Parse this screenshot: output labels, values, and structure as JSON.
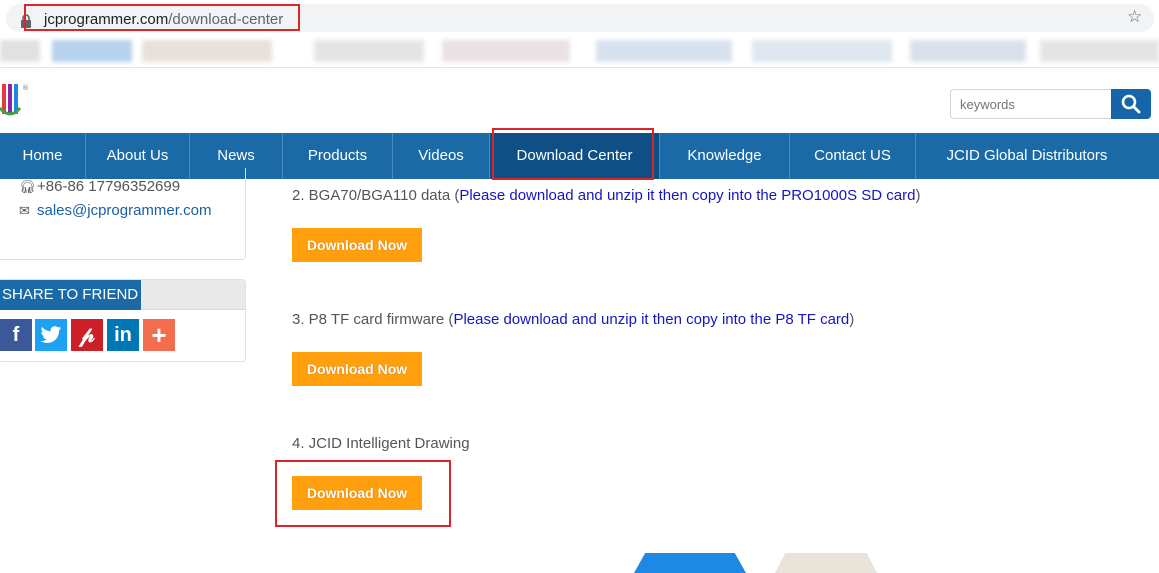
{
  "browser": {
    "url_domain": "jcprogrammer.com",
    "url_path": "/download-center"
  },
  "header": {
    "search_placeholder": "keywords"
  },
  "nav": {
    "items": [
      {
        "label": "Home"
      },
      {
        "label": "About Us"
      },
      {
        "label": "News"
      },
      {
        "label": "Products"
      },
      {
        "label": "Videos"
      },
      {
        "label": "Download Center",
        "active": true
      },
      {
        "label": "Knowledge"
      },
      {
        "label": "Contact US"
      },
      {
        "label": "JCID Global Distributors"
      }
    ]
  },
  "sidebar": {
    "phone": "+86-86 17796352699",
    "email": "sales@jcprogrammer.com",
    "share_title": "SHARE TO FRIEND",
    "social": [
      {
        "name": "facebook-icon",
        "glyph": "f",
        "color": "#3b5998"
      },
      {
        "name": "twitter-icon",
        "glyph": "t",
        "color": "#1da1f2"
      },
      {
        "name": "pinterest-icon",
        "glyph": "p",
        "color": "#cb2027"
      },
      {
        "name": "linkedin-icon",
        "glyph": "in",
        "color": "#0077b5"
      },
      {
        "name": "more-icon",
        "glyph": "+",
        "color": "#f26c4f"
      }
    ]
  },
  "downloads": [
    {
      "title": "2. BGA70/BGA110 data (",
      "note": "Please download and unzip it then copy into the PRO1000S SD card",
      "close": ")",
      "button": "Download Now"
    },
    {
      "title": "3. P8 TF card firmware (",
      "note": "Please download and unzip it then copy into the P8 TF card",
      "close": ")",
      "button": "Download Now"
    },
    {
      "title": "4. JCID Intelligent Drawing",
      "note": "",
      "close": "",
      "button": "Download Now"
    }
  ],
  "colors": {
    "nav_bg": "#1a6aa8",
    "nav_active": "#0e4f86",
    "download_button": "#ff9f0d",
    "highlight": "#d9262c"
  }
}
